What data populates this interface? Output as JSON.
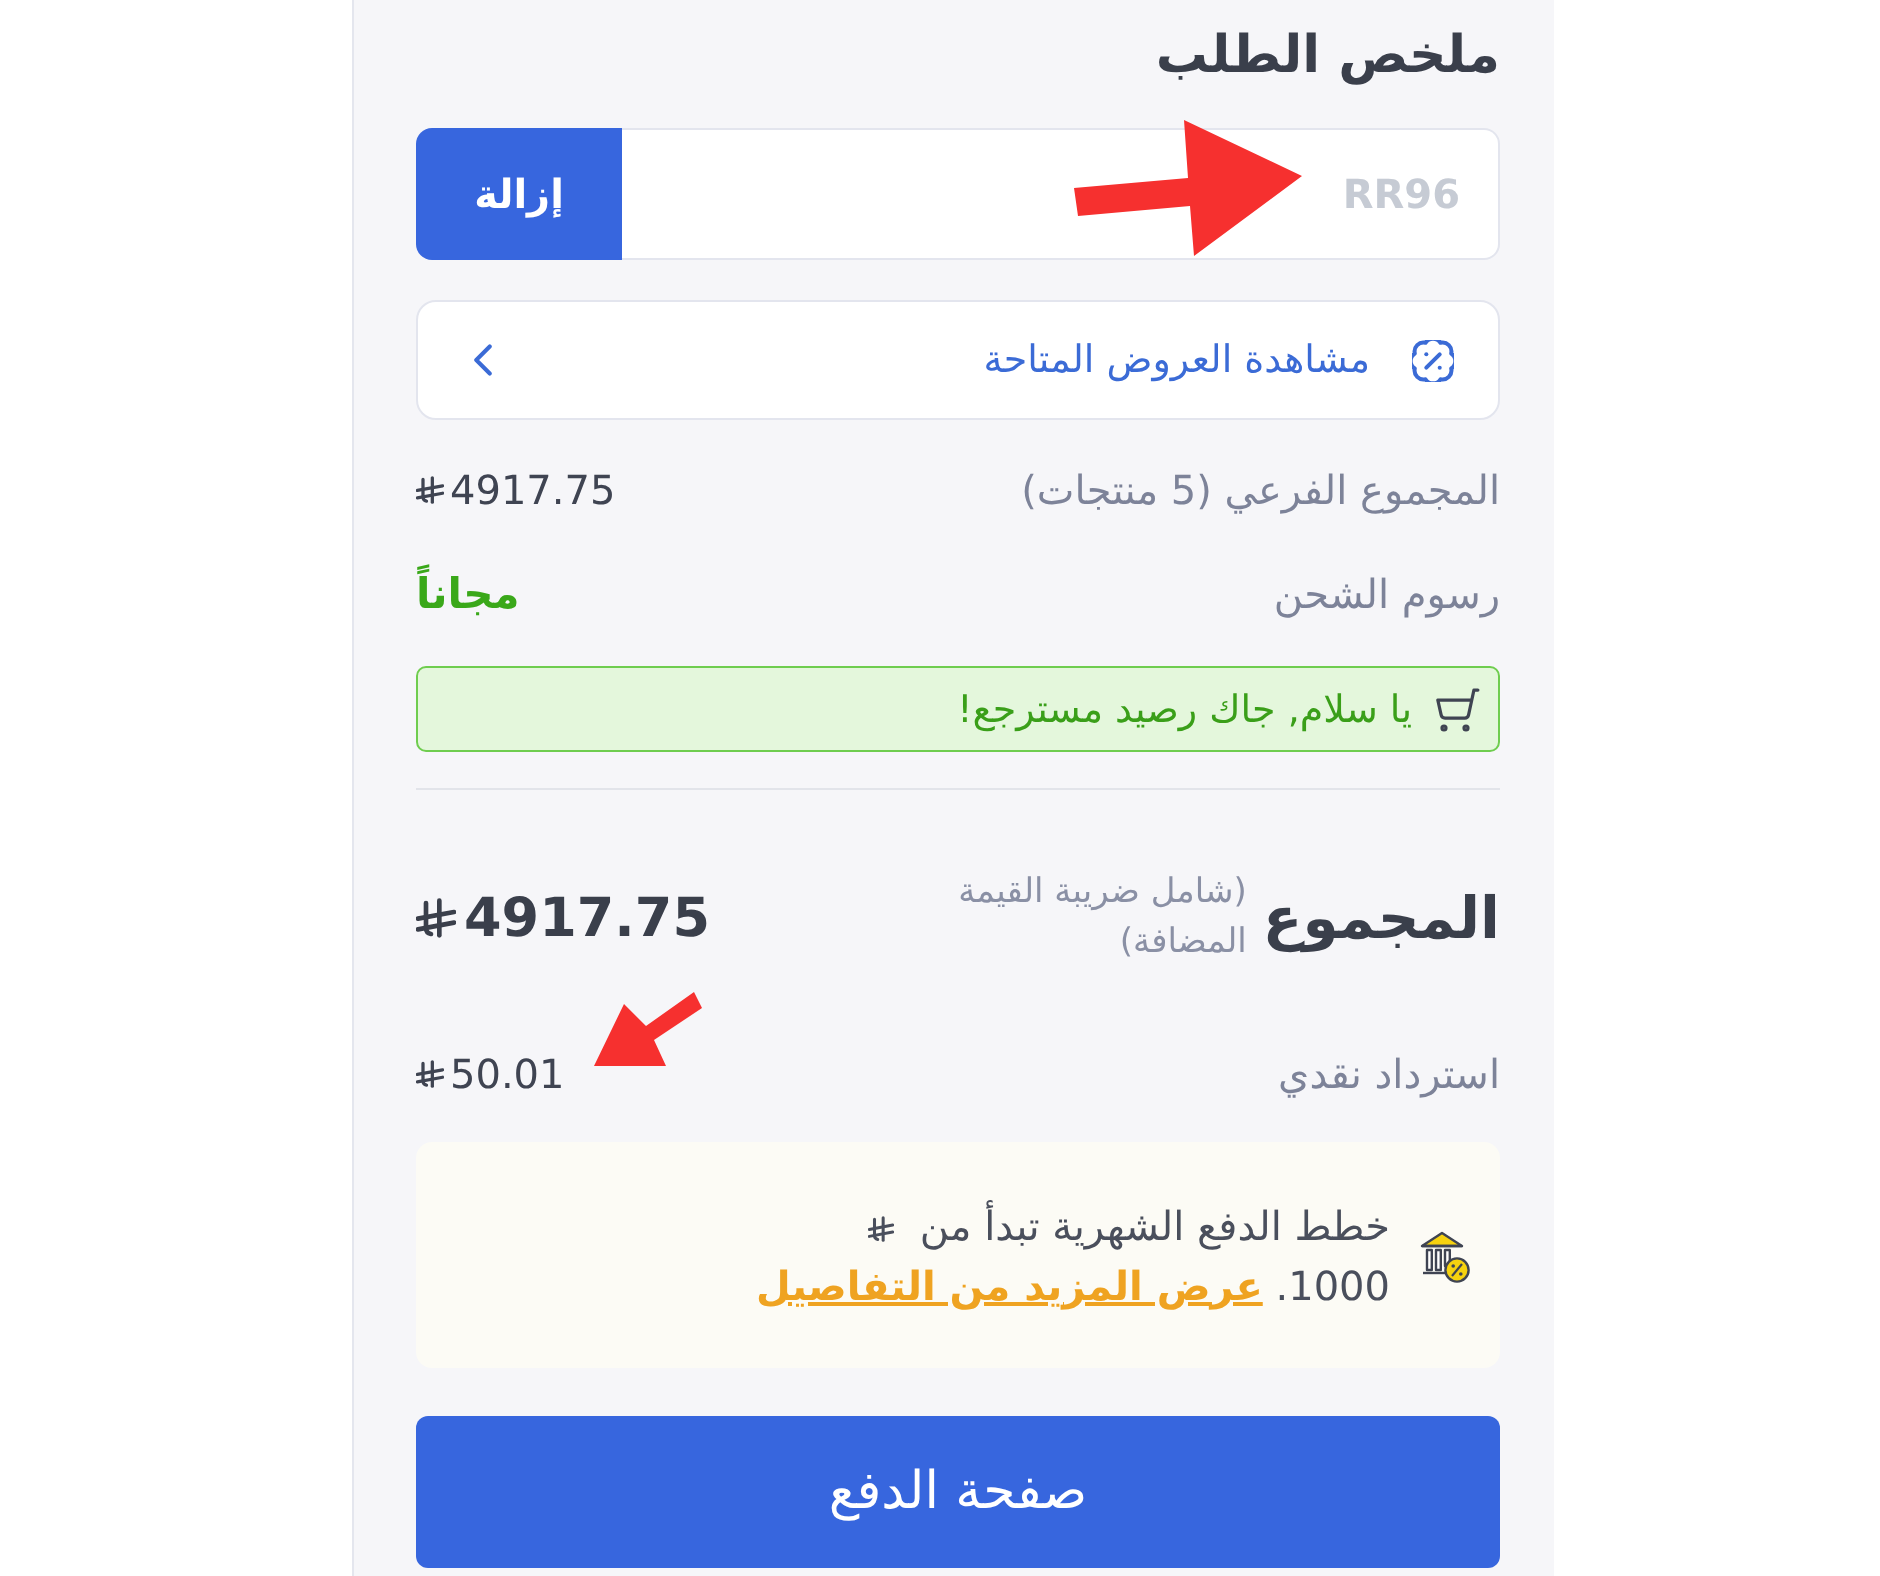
{
  "title": "ملخص الطلب",
  "coupon": {
    "value": "RR96",
    "disabled": true,
    "button": "إزالة"
  },
  "offers_link": {
    "label": "مشاهدة العروض المتاحة"
  },
  "summary_rows": [
    {
      "kind": "amount",
      "label": "المجموع الفرعي (5 منتجات)",
      "value": "4917.75"
    },
    {
      "kind": "status",
      "label": "رسوم الشحن",
      "value": "مجاناً"
    }
  ],
  "notice": {
    "text": "يا سلام, جاك رصيد مسترجع!"
  },
  "total": {
    "label": "المجموع",
    "note": "(شامل ضريبة القيمة المضافة)",
    "value": "4917.75"
  },
  "cashback": {
    "label": "استرداد نقدي",
    "value": "50.01"
  },
  "payment_plans": {
    "text": "خطط الدفع الشهرية تبدأ من",
    "amount": "1000.",
    "link": "عرض المزيد من التفاصيل"
  },
  "checkout_button": {
    "label": "صفحة الدفع"
  }
}
